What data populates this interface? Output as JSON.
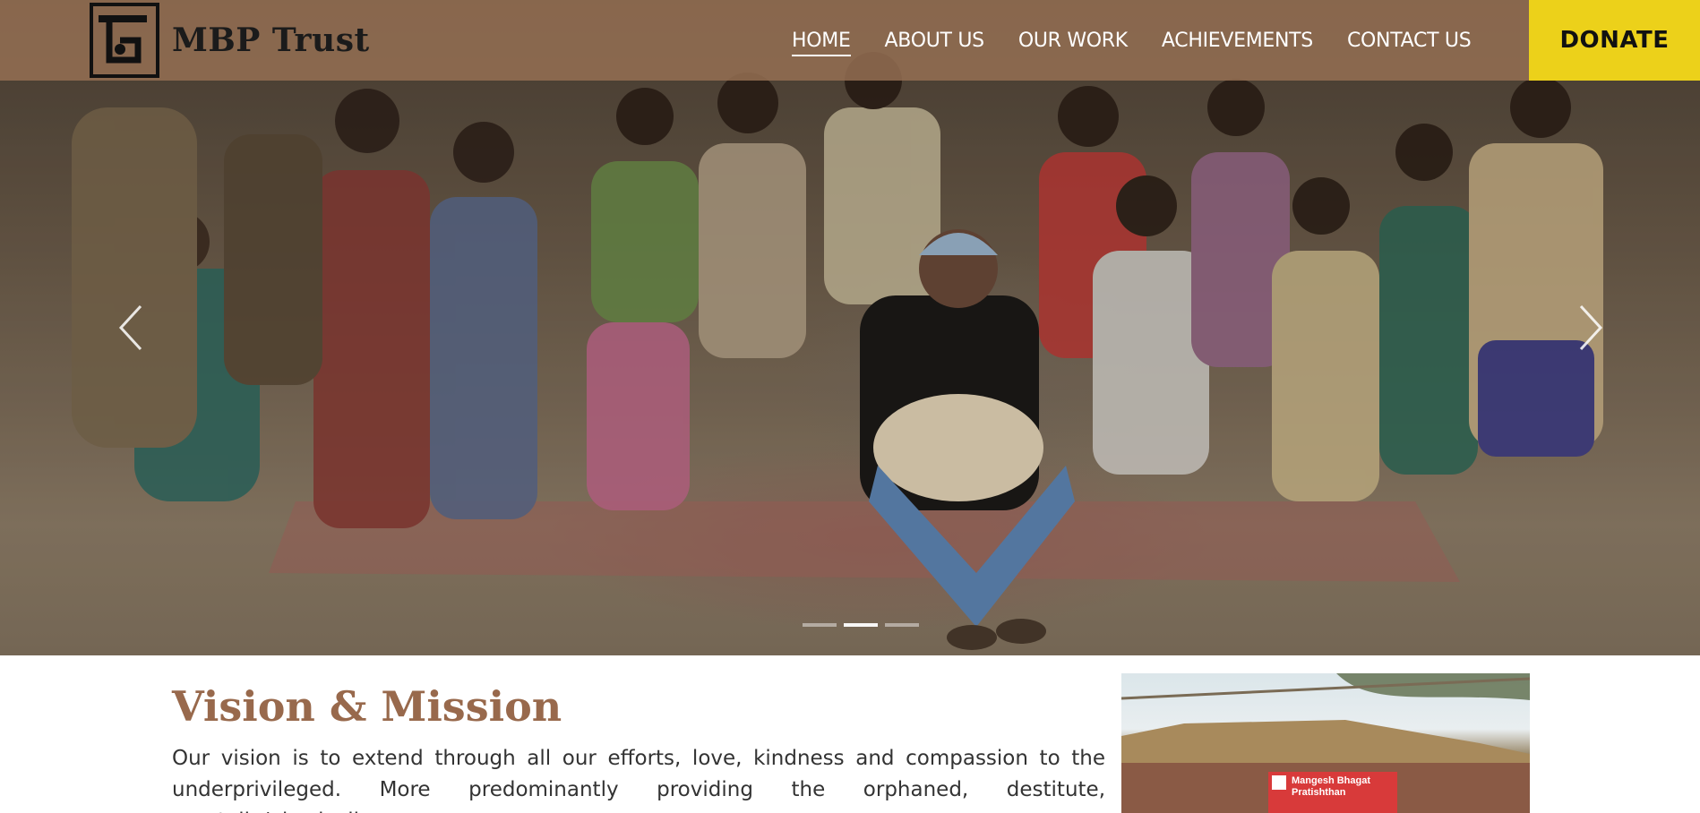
{
  "brand": {
    "name": "MBP Trust"
  },
  "nav": {
    "items": [
      {
        "label": "HOME",
        "active": true
      },
      {
        "label": "ABOUT US",
        "active": false
      },
      {
        "label": "OUR WORK",
        "active": false
      },
      {
        "label": "ACHIEVEMENTS",
        "active": false
      },
      {
        "label": "CONTACT US",
        "active": false
      }
    ],
    "donate_label": "DONATE"
  },
  "carousel": {
    "slide_count": 3,
    "active_index": 1,
    "prev_icon": "chevron-left-icon",
    "next_icon": "chevron-right-icon"
  },
  "vision": {
    "title": "Vision & Mission",
    "text": "Our vision is to extend through all our efforts, love, kindness and compassion to the underprivileged. More predominantly providing the orphaned, destitute, mentally/physically",
    "photo_banner_text": "Mangesh Bhagat Pratishthan"
  },
  "colors": {
    "header_bg": "#96704f",
    "donate_bg": "#ecd11a",
    "heading_brown": "#98694c",
    "body_text": "#333333"
  }
}
